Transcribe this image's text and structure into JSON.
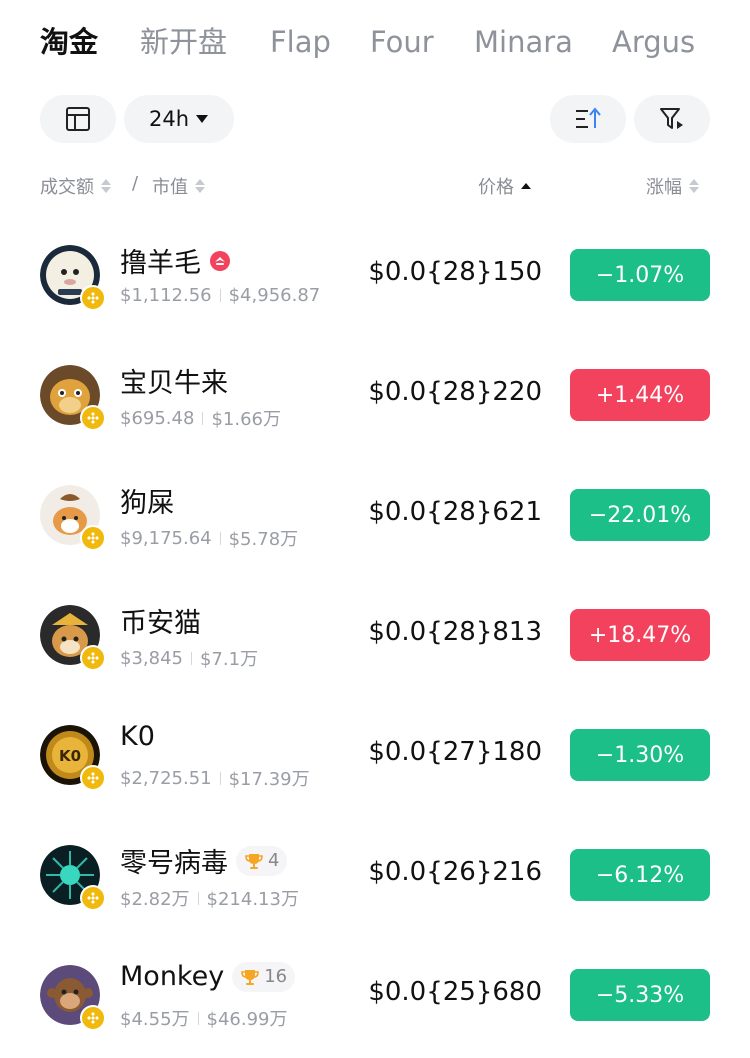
{
  "tabs": [
    {
      "label": "淘金",
      "active": true
    },
    {
      "label": "新开盘",
      "active": false
    },
    {
      "label": "Flap",
      "active": false
    },
    {
      "label": "Four",
      "active": false
    },
    {
      "label": "Minara",
      "active": false
    },
    {
      "label": "Argus",
      "active": false
    }
  ],
  "toolbar": {
    "layout_icon": "layout-icon",
    "timeframe": "24h",
    "sort_icon": "sort-ascending-icon",
    "filter_icon": "filter-icon"
  },
  "columns": {
    "volume": "成交额",
    "slash": "/",
    "market_cap": "市值",
    "price": "价格",
    "change": "涨幅"
  },
  "colors": {
    "down": "#1bbf87",
    "up": "#f2425d",
    "chain_badge": "#f0b90b",
    "hot_badge": "#f2425d",
    "trophy": "#f5a623"
  },
  "tokens": [
    {
      "name": "撸羊毛",
      "badge": "hot-badge-icon",
      "volume": "$1,112.56",
      "market_cap": "$4,956.87",
      "price": "$0.0{28}150",
      "change": "−1.07%",
      "direction": "down",
      "avatar": "sheep-avatar"
    },
    {
      "name": "宝贝牛来",
      "volume": "$695.48",
      "market_cap": "$1.66万",
      "price": "$0.0{28}220",
      "change": "+1.44%",
      "direction": "up",
      "avatar": "cow-avatar"
    },
    {
      "name": "狗屎",
      "volume": "$9,175.64",
      "market_cap": "$5.78万",
      "price": "$0.0{28}621",
      "change": "−22.01%",
      "direction": "down",
      "avatar": "dog-avatar"
    },
    {
      "name": "币安猫",
      "volume": "$3,845",
      "market_cap": "$7.1万",
      "price": "$0.0{28}813",
      "change": "+18.47%",
      "direction": "up",
      "avatar": "cat-avatar"
    },
    {
      "name": "K0",
      "volume": "$2,725.51",
      "market_cap": "$17.39万",
      "price": "$0.0{27}180",
      "change": "−1.30%",
      "direction": "down",
      "avatar": "coin-avatar"
    },
    {
      "name": "零号病毒",
      "rank": "4",
      "volume": "$2.82万",
      "market_cap": "$214.13万",
      "price": "$0.0{26}216",
      "change": "−6.12%",
      "direction": "down",
      "avatar": "virus-avatar"
    },
    {
      "name": "Monkey",
      "rank": "16",
      "volume": "$4.55万",
      "market_cap": "$46.99万",
      "price": "$0.0{25}680",
      "change": "−5.33%",
      "direction": "down",
      "avatar": "monkey-avatar"
    }
  ]
}
